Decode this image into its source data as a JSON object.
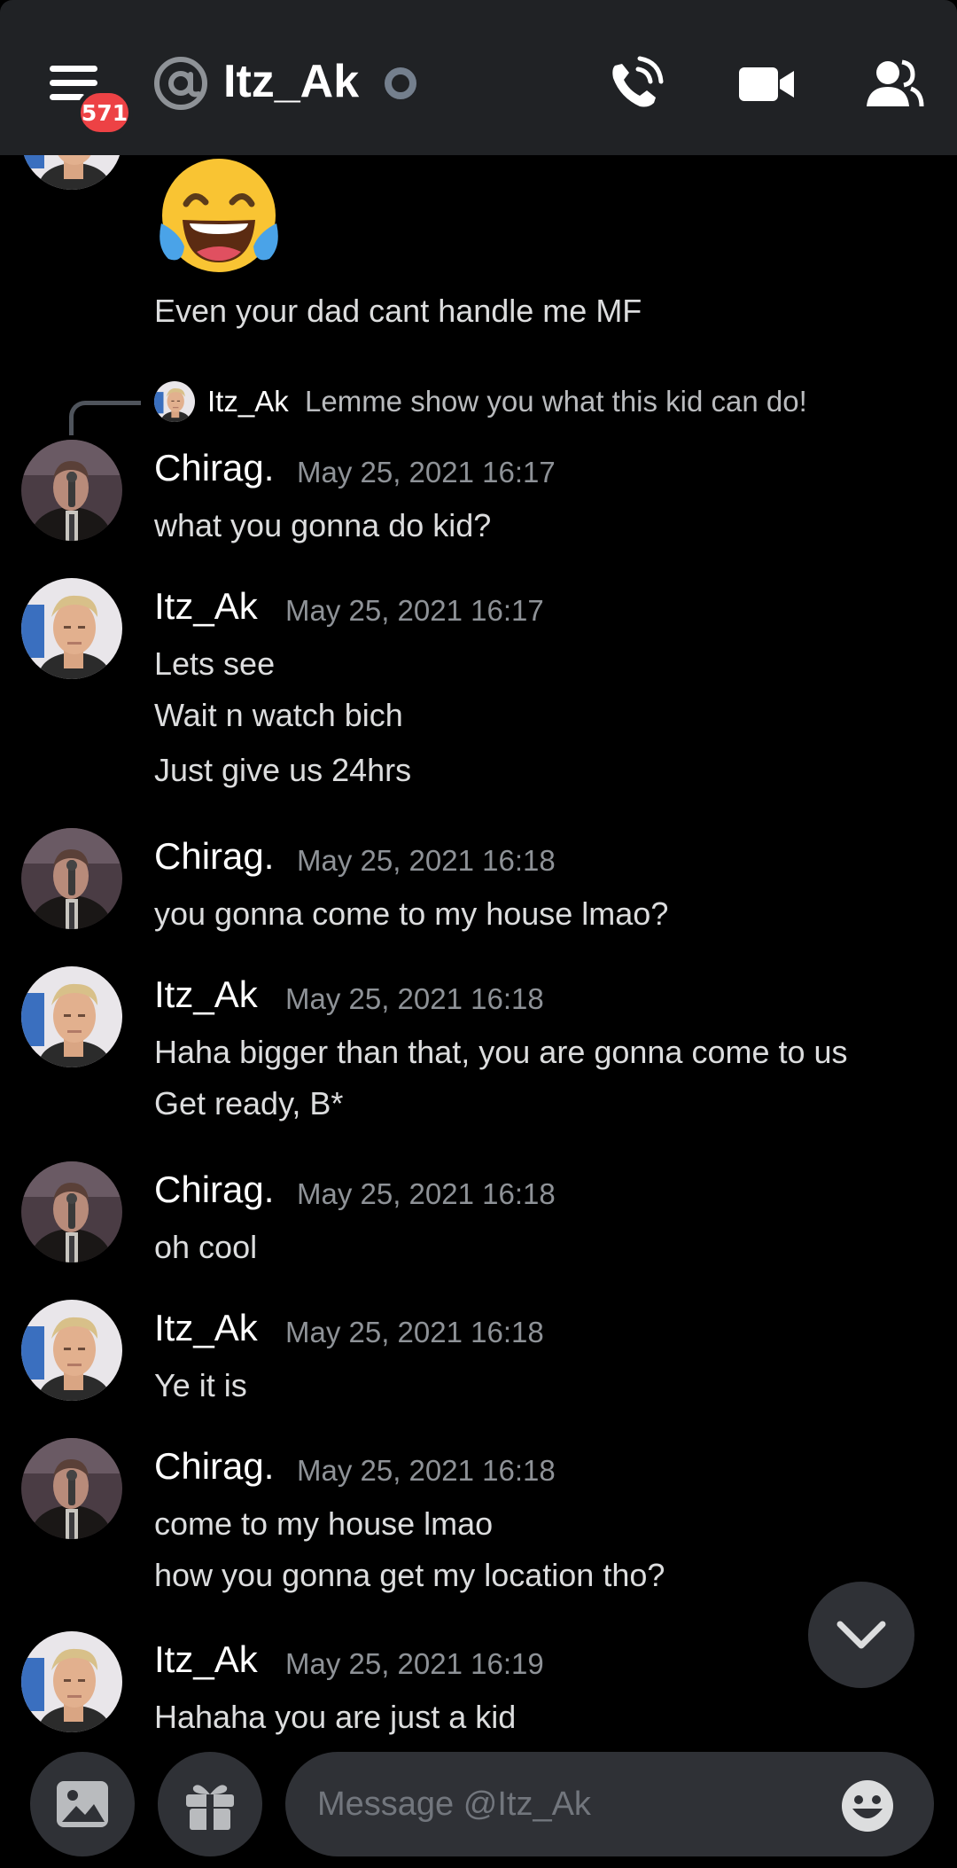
{
  "header": {
    "title": "Itz_Ak",
    "badge_count": "571"
  },
  "top_message": {
    "text": "Even your dad cant handle me MF"
  },
  "reply_ref": {
    "author": "Itz_Ak",
    "text": "Lemme show you what this kid can do!"
  },
  "messages": [
    {
      "author": "Chirag.",
      "timestamp": "May 25, 2021 16:17",
      "lines": [
        "what you gonna do kid?"
      ]
    },
    {
      "author": "Itz_Ak",
      "timestamp": "May 25, 2021 16:17",
      "lines": [
        "Lets see",
        "Wait n watch bich",
        "Just give us 24hrs"
      ]
    },
    {
      "author": "Chirag.",
      "timestamp": "May 25, 2021 16:18",
      "lines": [
        "you gonna come to my house lmao?"
      ]
    },
    {
      "author": "Itz_Ak",
      "timestamp": "May 25, 2021 16:18",
      "lines": [
        "Haha bigger than that, you are gonna come to us",
        "Get ready, B*"
      ]
    },
    {
      "author": "Chirag.",
      "timestamp": "May 25, 2021 16:18",
      "lines": [
        "oh cool"
      ]
    },
    {
      "author": "Itz_Ak",
      "timestamp": "May 25, 2021 16:18",
      "lines": [
        "Ye it is"
      ]
    },
    {
      "author": "Chirag.",
      "timestamp": "May 25, 2021 16:18",
      "lines": [
        "come to my house lmao",
        "how you gonna get my location tho?"
      ]
    },
    {
      "author": "Itz_Ak",
      "timestamp": "May 25, 2021 16:19",
      "lines": [
        "Hahaha you are just a kid"
      ]
    }
  ],
  "composer": {
    "placeholder": "Message @Itz_Ak"
  },
  "icons": {
    "menu": "hamburger-menu-icon",
    "at": "at-sign-icon",
    "status": "status-offline-dot",
    "call": "phone-call-icon",
    "video": "video-camera-icon",
    "members": "members-icon",
    "scroll": "chevron-down-icon",
    "image": "image-icon",
    "gift": "gift-icon",
    "emoji": "emoji-smile-icon"
  },
  "colors": {
    "background": "#000000",
    "header": "#202225",
    "badge": "#ed4245",
    "muted": "#8e9297",
    "input": "#2f3136"
  }
}
